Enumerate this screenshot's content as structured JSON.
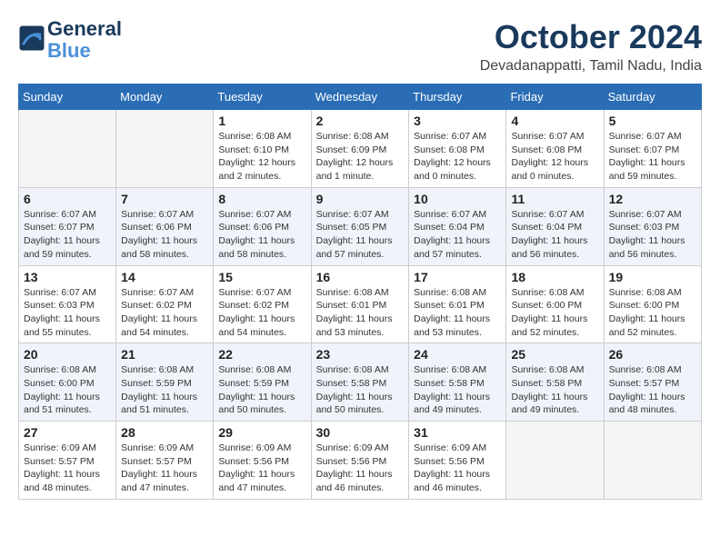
{
  "header": {
    "logo_line1": "General",
    "logo_line2": "Blue",
    "month": "October 2024",
    "location": "Devadanappatti, Tamil Nadu, India"
  },
  "weekdays": [
    "Sunday",
    "Monday",
    "Tuesday",
    "Wednesday",
    "Thursday",
    "Friday",
    "Saturday"
  ],
  "weeks": [
    [
      {
        "day": "",
        "empty": true
      },
      {
        "day": "",
        "empty": true
      },
      {
        "day": "1",
        "sunrise": "6:08 AM",
        "sunset": "6:10 PM",
        "daylight": "12 hours and 2 minutes."
      },
      {
        "day": "2",
        "sunrise": "6:08 AM",
        "sunset": "6:09 PM",
        "daylight": "12 hours and 1 minute."
      },
      {
        "day": "3",
        "sunrise": "6:07 AM",
        "sunset": "6:08 PM",
        "daylight": "12 hours and 0 minutes."
      },
      {
        "day": "4",
        "sunrise": "6:07 AM",
        "sunset": "6:08 PM",
        "daylight": "12 hours and 0 minutes."
      },
      {
        "day": "5",
        "sunrise": "6:07 AM",
        "sunset": "6:07 PM",
        "daylight": "11 hours and 59 minutes."
      }
    ],
    [
      {
        "day": "6",
        "sunrise": "6:07 AM",
        "sunset": "6:07 PM",
        "daylight": "11 hours and 59 minutes."
      },
      {
        "day": "7",
        "sunrise": "6:07 AM",
        "sunset": "6:06 PM",
        "daylight": "11 hours and 58 minutes."
      },
      {
        "day": "8",
        "sunrise": "6:07 AM",
        "sunset": "6:06 PM",
        "daylight": "11 hours and 58 minutes."
      },
      {
        "day": "9",
        "sunrise": "6:07 AM",
        "sunset": "6:05 PM",
        "daylight": "11 hours and 57 minutes."
      },
      {
        "day": "10",
        "sunrise": "6:07 AM",
        "sunset": "6:04 PM",
        "daylight": "11 hours and 57 minutes."
      },
      {
        "day": "11",
        "sunrise": "6:07 AM",
        "sunset": "6:04 PM",
        "daylight": "11 hours and 56 minutes."
      },
      {
        "day": "12",
        "sunrise": "6:07 AM",
        "sunset": "6:03 PM",
        "daylight": "11 hours and 56 minutes."
      }
    ],
    [
      {
        "day": "13",
        "sunrise": "6:07 AM",
        "sunset": "6:03 PM",
        "daylight": "11 hours and 55 minutes."
      },
      {
        "day": "14",
        "sunrise": "6:07 AM",
        "sunset": "6:02 PM",
        "daylight": "11 hours and 54 minutes."
      },
      {
        "day": "15",
        "sunrise": "6:07 AM",
        "sunset": "6:02 PM",
        "daylight": "11 hours and 54 minutes."
      },
      {
        "day": "16",
        "sunrise": "6:08 AM",
        "sunset": "6:01 PM",
        "daylight": "11 hours and 53 minutes."
      },
      {
        "day": "17",
        "sunrise": "6:08 AM",
        "sunset": "6:01 PM",
        "daylight": "11 hours and 53 minutes."
      },
      {
        "day": "18",
        "sunrise": "6:08 AM",
        "sunset": "6:00 PM",
        "daylight": "11 hours and 52 minutes."
      },
      {
        "day": "19",
        "sunrise": "6:08 AM",
        "sunset": "6:00 PM",
        "daylight": "11 hours and 52 minutes."
      }
    ],
    [
      {
        "day": "20",
        "sunrise": "6:08 AM",
        "sunset": "6:00 PM",
        "daylight": "11 hours and 51 minutes."
      },
      {
        "day": "21",
        "sunrise": "6:08 AM",
        "sunset": "5:59 PM",
        "daylight": "11 hours and 51 minutes."
      },
      {
        "day": "22",
        "sunrise": "6:08 AM",
        "sunset": "5:59 PM",
        "daylight": "11 hours and 50 minutes."
      },
      {
        "day": "23",
        "sunrise": "6:08 AM",
        "sunset": "5:58 PM",
        "daylight": "11 hours and 50 minutes."
      },
      {
        "day": "24",
        "sunrise": "6:08 AM",
        "sunset": "5:58 PM",
        "daylight": "11 hours and 49 minutes."
      },
      {
        "day": "25",
        "sunrise": "6:08 AM",
        "sunset": "5:58 PM",
        "daylight": "11 hours and 49 minutes."
      },
      {
        "day": "26",
        "sunrise": "6:08 AM",
        "sunset": "5:57 PM",
        "daylight": "11 hours and 48 minutes."
      }
    ],
    [
      {
        "day": "27",
        "sunrise": "6:09 AM",
        "sunset": "5:57 PM",
        "daylight": "11 hours and 48 minutes."
      },
      {
        "day": "28",
        "sunrise": "6:09 AM",
        "sunset": "5:57 PM",
        "daylight": "11 hours and 47 minutes."
      },
      {
        "day": "29",
        "sunrise": "6:09 AM",
        "sunset": "5:56 PM",
        "daylight": "11 hours and 47 minutes."
      },
      {
        "day": "30",
        "sunrise": "6:09 AM",
        "sunset": "5:56 PM",
        "daylight": "11 hours and 46 minutes."
      },
      {
        "day": "31",
        "sunrise": "6:09 AM",
        "sunset": "5:56 PM",
        "daylight": "11 hours and 46 minutes."
      },
      {
        "day": "",
        "empty": true
      },
      {
        "day": "",
        "empty": true
      }
    ]
  ]
}
